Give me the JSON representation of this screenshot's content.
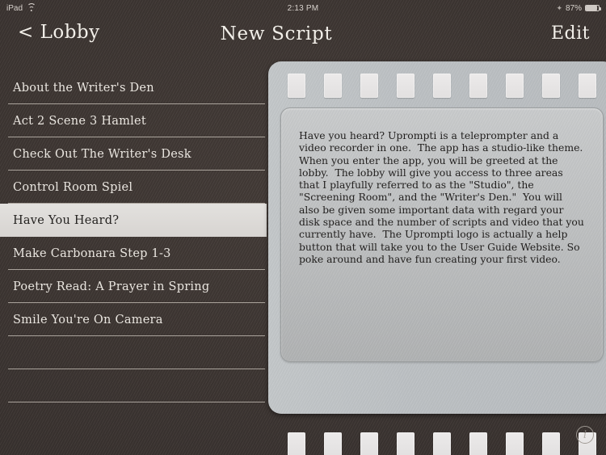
{
  "statusbar": {
    "device_label": "iPad",
    "wifi_icon": "wifi-icon",
    "time": "2:13 PM",
    "bluetooth_icon": "bluetooth-icon",
    "battery_percent": "87%",
    "battery_icon": "battery-icon",
    "battery_level": 87
  },
  "header": {
    "back_label": "< Lobby",
    "title": "New Script",
    "edit_label": "Edit"
  },
  "sidebar": {
    "items": [
      {
        "label": "About the Writer's Den",
        "selected": false
      },
      {
        "label": "Act 2 Scene 3 Hamlet",
        "selected": false
      },
      {
        "label": "Check Out The Writer's Desk",
        "selected": false
      },
      {
        "label": "Control Room Spiel",
        "selected": false
      },
      {
        "label": "Have You Heard?",
        "selected": true
      },
      {
        "label": "Make Carbonara Step 1-3",
        "selected": false
      },
      {
        "label": "Poetry Read: A Prayer in Spring",
        "selected": false
      },
      {
        "label": "Smile You're On Camera",
        "selected": false
      },
      {
        "label": "",
        "selected": false
      },
      {
        "label": "",
        "selected": false
      }
    ]
  },
  "film_panel": {
    "sprocket_count_top": 9,
    "sprocket_count_bottom": 9,
    "script_text": "Have you heard? Uprompti is a teleprompter and a video recorder in one.  The app has a studio-like theme.  When you enter the app, you will be greeted at the lobby.  The lobby will give you access to three areas that I playfully referred to as the \"Studio\", the \"Screening Room\", and the \"Writer's Den.\"  You will also be given some important data with regard your disk space and the number of scripts and video that you currently have.  The Uprompti logo is actually a help button that will take you to the User Guide Website. So poke around and have fun creating your first video."
  },
  "info_button": {
    "glyph": "i",
    "icon": "info-icon"
  },
  "colors": {
    "backdrop": "#3b3431",
    "panel": "#bcc0c3",
    "script_box": "#bcbebf",
    "selected_row": "#dddbd8",
    "text_light": "#eae6e0",
    "text_dark": "#22201f",
    "separator": "#bdb6ae"
  }
}
